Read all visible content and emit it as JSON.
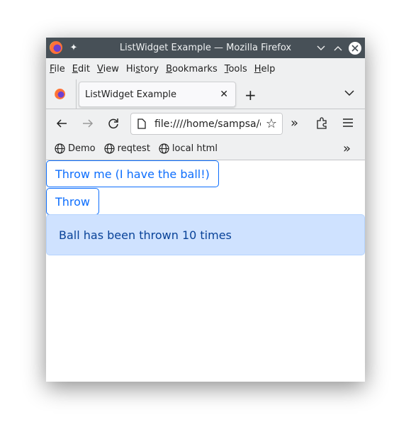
{
  "window": {
    "title": "ListWidget Example — Mozilla Firefox"
  },
  "menu": [
    {
      "label": "File",
      "u": "F",
      "rest": "ile"
    },
    {
      "label": "Edit",
      "u": "E",
      "rest": "dit"
    },
    {
      "label": "View",
      "u": "V",
      "rest": "iew"
    },
    {
      "label": "History",
      "pre": "Hi",
      "u": "s",
      "rest": "tory"
    },
    {
      "label": "Bookmarks",
      "u": "B",
      "rest": "ookmarks"
    },
    {
      "label": "Tools",
      "u": "T",
      "rest": "ools"
    },
    {
      "label": "Help",
      "u": "H",
      "rest": "elp"
    }
  ],
  "tab": {
    "title": "ListWidget Example"
  },
  "url": "file:////home/sampsa/q",
  "bookmarks": [
    "Demo",
    "reqtest",
    "local html"
  ],
  "page": {
    "button1": "Throw me (I have the ball!)",
    "button2": "Throw",
    "alert": "Ball has been thrown 10 times"
  },
  "colors": {
    "primary": "#0d6efd",
    "alert_bg": "#cfe2ff",
    "alert_text": "#084298",
    "titlebar": "#475057"
  }
}
